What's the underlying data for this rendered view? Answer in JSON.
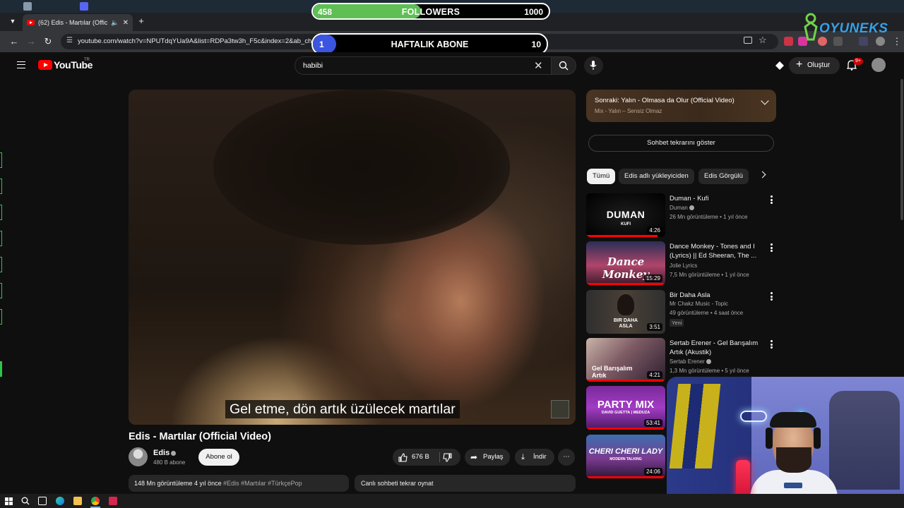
{
  "browser": {
    "tab_title": "(62) Edis - Martılar (Official",
    "url": "youtube.com/watch?v=NPUTdqYUa9A&list=RDPa3tw3h_F5c&index=2&ab_chan"
  },
  "overlay": {
    "followers_current": "458",
    "followers_label": "FOLLOWERS",
    "followers_goal": "1000",
    "followers_progress": 0.458,
    "weekly_current": "1",
    "weekly_label": "HAFTALIK ABONE",
    "weekly_goal": "10",
    "weekly_progress": 0.1,
    "brand": "OYUNEKS"
  },
  "yt_header": {
    "logo_text": "YouTube",
    "country_code": "TR",
    "search_value": "habibi",
    "create_label": "Oluştur",
    "notif_count": "9+"
  },
  "video": {
    "subtitle": "Gel etme, dön artık üzülecek martılar",
    "title": "Edis - Martılar (Official Video)",
    "channel": "Edis",
    "subscribers": "480 B abone",
    "subscribe_label": "Abone ol",
    "likes": "676 B",
    "share_label": "Paylaş",
    "download_label": "İndir",
    "desc_stats": "148 Mn görüntüleme  4 yıl önce",
    "desc_tags": "#Edis #Martılar #TürkçePop",
    "chat_replay_label": "Canlı sohbeti tekrar oynat"
  },
  "sidebar": {
    "next_title": "Sonraki: Yalın - Olmasa da Olur (Official Video)",
    "next_sub": "Mix - Yalın – Sensiz Olmaz",
    "chat_button": "Sohbet tekrarını göster",
    "chips": [
      "Tümü",
      "Edis adlı yükleyiciden",
      "Edis Görgülü"
    ],
    "recs": [
      {
        "title": "Duman - Kufi",
        "channel": "Duman",
        "meta": "26 Mn görüntüleme • 1 yıl önce",
        "duration": "4:26",
        "thumb_text": "DUMAN",
        "thumb_sub": "KUFI",
        "progress": 0.9
      },
      {
        "title": "Dance Monkey - Tones and I (Lyrics) || Ed Sheeran, The ...",
        "channel": "Jolie Lyrics",
        "meta": "7,5 Mn görüntüleme • 1 yıl önce",
        "duration": "15:29",
        "thumb_text": "Dance Monkey",
        "progress": 1.0
      },
      {
        "title": "Bir Daha Asla",
        "channel": "Mr Chakz Music - Topic",
        "meta": "49 görüntüleme • 4 saat önce",
        "duration": "3:51",
        "thumb_text": "BIR DAHA ASLA",
        "badge": "Yeni"
      },
      {
        "title": "Sertab Erener - Gel Barışalım Artık (Akustik)",
        "channel": "Sertab Erener",
        "meta": "1,3 Mn görüntüleme • 5 yıl önce",
        "duration": "4:21",
        "thumb_text": "Gel Barışalım Artık",
        "progress": 1.0
      },
      {
        "duration": "53:41",
        "thumb_text": "PARTY MIX",
        "thumb_sub": "DAVID GUETTA | MEDUZA",
        "progress": 1.0
      },
      {
        "duration": "24:06",
        "thumb_text": "CHERI CHERI LADY",
        "thumb_sub": "MODERN TALKING",
        "progress": 1.0
      }
    ]
  }
}
